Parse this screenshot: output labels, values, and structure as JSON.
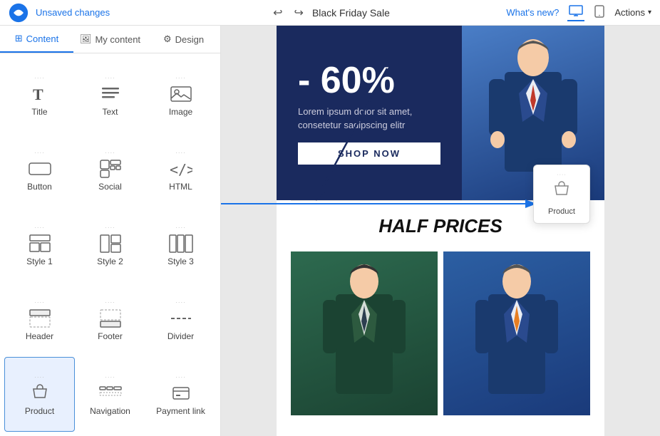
{
  "topbar": {
    "title": "Black Friday Sale",
    "unsaved_label": "Unsaved changes",
    "whats_new_label": "What's new?",
    "actions_label": "Actions",
    "undo_symbol": "↩",
    "redo_symbol": "↪"
  },
  "sidebar": {
    "tabs": [
      {
        "id": "content",
        "label": "Content",
        "icon": "⊞"
      },
      {
        "id": "my-content",
        "label": "My content",
        "icon": "🖼"
      },
      {
        "id": "design",
        "label": "Design",
        "icon": "⚙"
      }
    ],
    "active_tab": "content",
    "items": [
      {
        "id": "title",
        "label": "Title",
        "icon": "T"
      },
      {
        "id": "text",
        "label": "Text",
        "icon": "lines"
      },
      {
        "id": "image",
        "label": "Image",
        "icon": "img"
      },
      {
        "id": "button",
        "label": "Button",
        "icon": "btn"
      },
      {
        "id": "social",
        "label": "Social",
        "icon": "social"
      },
      {
        "id": "html",
        "label": "HTML",
        "icon": "<>"
      },
      {
        "id": "style1",
        "label": "Style 1",
        "icon": "style1"
      },
      {
        "id": "style2",
        "label": "Style 2",
        "icon": "style2"
      },
      {
        "id": "style3",
        "label": "Style 3",
        "icon": "style3"
      },
      {
        "id": "header",
        "label": "Header",
        "icon": "header"
      },
      {
        "id": "footer",
        "label": "Footer",
        "icon": "footer"
      },
      {
        "id": "divider",
        "label": "Divider",
        "icon": "divider"
      },
      {
        "id": "product",
        "label": "Product",
        "icon": "product",
        "selected": true
      },
      {
        "id": "navigation",
        "label": "Navigation",
        "icon": "navigation"
      },
      {
        "id": "payment-link",
        "label": "Payment link",
        "icon": "payment"
      }
    ]
  },
  "canvas": {
    "hero": {
      "discount": "- 60%",
      "description": "Lorem ipsum dolor sit amet,\nconsetetur sadipscing elitr",
      "button_label": "SHOP NOW"
    },
    "section2": {
      "title": "HALF PRICES"
    },
    "tooltip": {
      "label": "Product",
      "dots": "····"
    }
  }
}
